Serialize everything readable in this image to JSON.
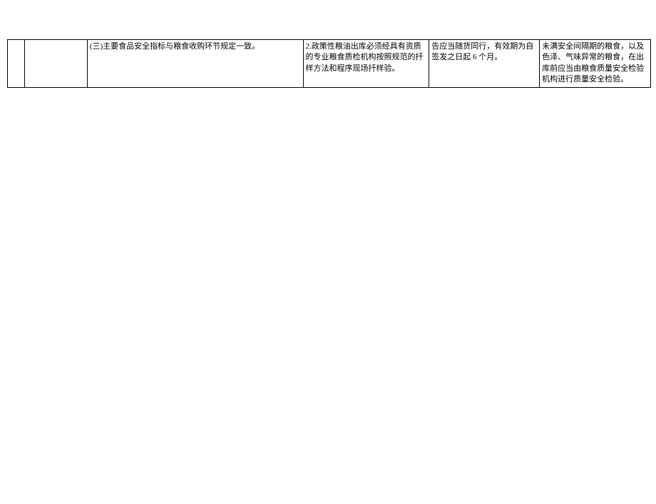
{
  "table": {
    "row": {
      "col1": "",
      "col2": "",
      "col3": "(三)主要食品安全指标与粮食收购环节规定一致。",
      "col4": "2.政策性粮油出库必须经具有资质的专业粮食质检机构按照规范的扦样方法和程序现场扦样验。",
      "col5": "告应当随货同行，有效期为自签发之日起 6 个月。",
      "col6": "未满安全间隔期的粮食，以及色泽、气味异常的粮食，在出库前应当由粮食质量安全检验机构进行质量安全检验。"
    }
  }
}
